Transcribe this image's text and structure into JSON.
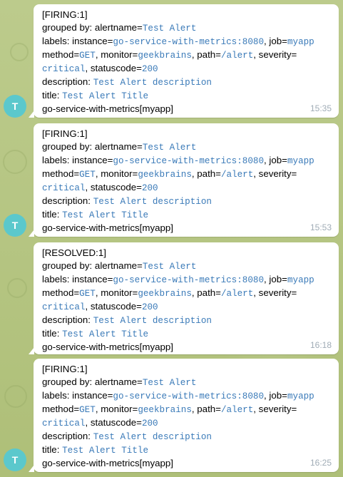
{
  "sender": {
    "avatar_letter": "T"
  },
  "colors": {
    "chat_background": "#b8c98a",
    "bubble": "#ffffff",
    "avatar": "#5bc8cc",
    "mono_text": "#3a7ab8",
    "timestamp": "#a0acb6"
  },
  "messages": [
    {
      "status": "[FIRING:1]",
      "grouped_prefix": "grouped by: alertname=",
      "alertname": "Test Alert",
      "labels_prefix": "labels: instance=",
      "instance": "go-service-with-metrics:8080",
      "job_sep": ", job=",
      "job": "myapp",
      "method_prefix": "method=",
      "method": "GET",
      "monitor_sep": ", monitor=",
      "monitor": "geekbrains",
      "path_sep": ", path=",
      "path": "/alert",
      "severity_sep": ", severity=",
      "severity": "critical",
      "statuscode_sep": ", statuscode=",
      "statuscode": "200",
      "description_prefix": "description: ",
      "description": "Test Alert description",
      "title_prefix": "title: ",
      "title": "Test Alert Title",
      "service": "go-service-with-metrics[myapp]",
      "time": "15:35"
    },
    {
      "status": "[FIRING:1]",
      "grouped_prefix": "grouped by: alertname=",
      "alertname": "Test Alert",
      "labels_prefix": "labels: instance=",
      "instance": "go-service-with-metrics:8080",
      "job_sep": ", job=",
      "job": "myapp",
      "method_prefix": "method=",
      "method": "GET",
      "monitor_sep": ", monitor=",
      "monitor": "geekbrains",
      "path_sep": ", path=",
      "path": "/alert",
      "severity_sep": ", severity=",
      "severity": "critical",
      "statuscode_sep": ", statuscode=",
      "statuscode": "200",
      "description_prefix": "description: ",
      "description": "Test Alert description",
      "title_prefix": "title: ",
      "title": "Test Alert Title",
      "service": "go-service-with-metrics[myapp]",
      "time": "15:53"
    },
    {
      "status": "[RESOLVED:1]",
      "grouped_prefix": "grouped by: alertname=",
      "alertname": "Test Alert",
      "labels_prefix": "labels: instance=",
      "instance": "go-service-with-metrics:8080",
      "job_sep": ", job=",
      "job": "myapp",
      "method_prefix": "method=",
      "method": "GET",
      "monitor_sep": ", monitor=",
      "monitor": "geekbrains",
      "path_sep": ", path=",
      "path": "/alert",
      "severity_sep": ", severity=",
      "severity": "critical",
      "statuscode_sep": ", statuscode=",
      "statuscode": "200",
      "description_prefix": "description: ",
      "description": "Test Alert description",
      "title_prefix": "title: ",
      "title": "Test Alert Title",
      "service": "go-service-with-metrics[myapp]",
      "time": "16:18"
    },
    {
      "status": "[FIRING:1]",
      "grouped_prefix": "grouped by: alertname=",
      "alertname": "Test Alert",
      "labels_prefix": "labels: instance=",
      "instance": "go-service-with-metrics:8080",
      "job_sep": ", job=",
      "job": "myapp",
      "method_prefix": "method=",
      "method": "GET",
      "monitor_sep": ", monitor=",
      "monitor": "geekbrains",
      "path_sep": ", path=",
      "path": "/alert",
      "severity_sep": ", severity=",
      "severity": "critical",
      "statuscode_sep": ", statuscode=",
      "statuscode": "200",
      "description_prefix": "description: ",
      "description": "Test Alert description",
      "title_prefix": "title: ",
      "title": "Test Alert Title",
      "service": "go-service-with-metrics[myapp]",
      "time": "16:25"
    }
  ]
}
